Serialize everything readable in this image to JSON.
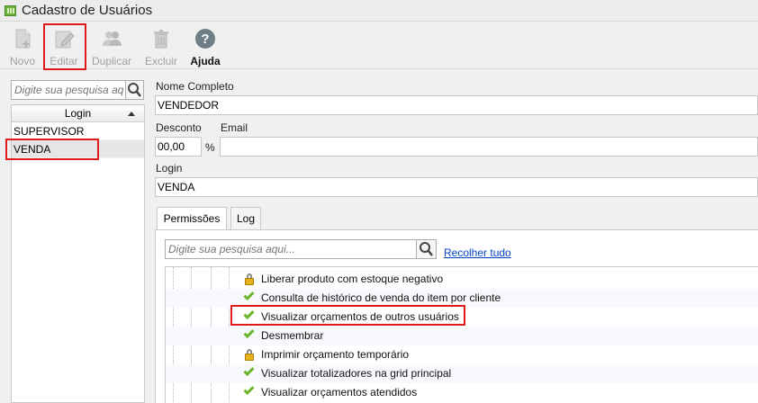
{
  "window": {
    "title": "Cadastro de Usuários"
  },
  "toolbar": {
    "buttons": [
      {
        "label": "Novo",
        "icon": "new-document-icon",
        "enabled": false
      },
      {
        "label": "Editar",
        "icon": "edit-pencil-icon",
        "enabled": false
      },
      {
        "label": "Duplicar",
        "icon": "users-duplicate-icon",
        "enabled": false
      },
      {
        "label": "Excluir",
        "icon": "trash-icon",
        "enabled": false
      },
      {
        "label": "Ajuda",
        "icon": "help-icon",
        "enabled": true
      }
    ]
  },
  "sidebar": {
    "search_placeholder": "Digite sua pesquisa aqui",
    "column_header": "Login",
    "rows": [
      "SUPERVISOR",
      "VENDA"
    ],
    "selected_index": 1
  },
  "form": {
    "full_name_label": "Nome Completo",
    "full_name_value": "VENDEDOR",
    "discount_label": "Desconto",
    "discount_value": "00,00",
    "discount_unit": "%",
    "email_label": "Email",
    "email_value": "",
    "login_label": "Login",
    "login_value": "VENDA"
  },
  "tabs": [
    "Permissões",
    "Log"
  ],
  "active_tab": 0,
  "permissions": {
    "search_placeholder": "Digite sua pesquisa aqui...",
    "collapse_link": "Recolher tudo",
    "items": [
      {
        "label": "Liberar produto com estoque negativo",
        "icon": "lock-icon"
      },
      {
        "label": "Consulta de histórico de venda do item por cliente",
        "icon": "check-icon"
      },
      {
        "label": "Visualizar orçamentos de outros usuários",
        "icon": "check-icon"
      },
      {
        "label": "Desmembrar",
        "icon": "check-icon"
      },
      {
        "label": "Imprimir orçamento temporário",
        "icon": "lock-icon"
      },
      {
        "label": "Visualizar totalizadores na grid principal",
        "icon": "check-icon"
      },
      {
        "label": "Visualizar orçamentos atendidos",
        "icon": "check-icon"
      }
    ]
  },
  "colors": {
    "highlight": "#e01b1b",
    "link": "#0645c8",
    "check": "#6bb52a",
    "lock": "#e6b21a"
  }
}
